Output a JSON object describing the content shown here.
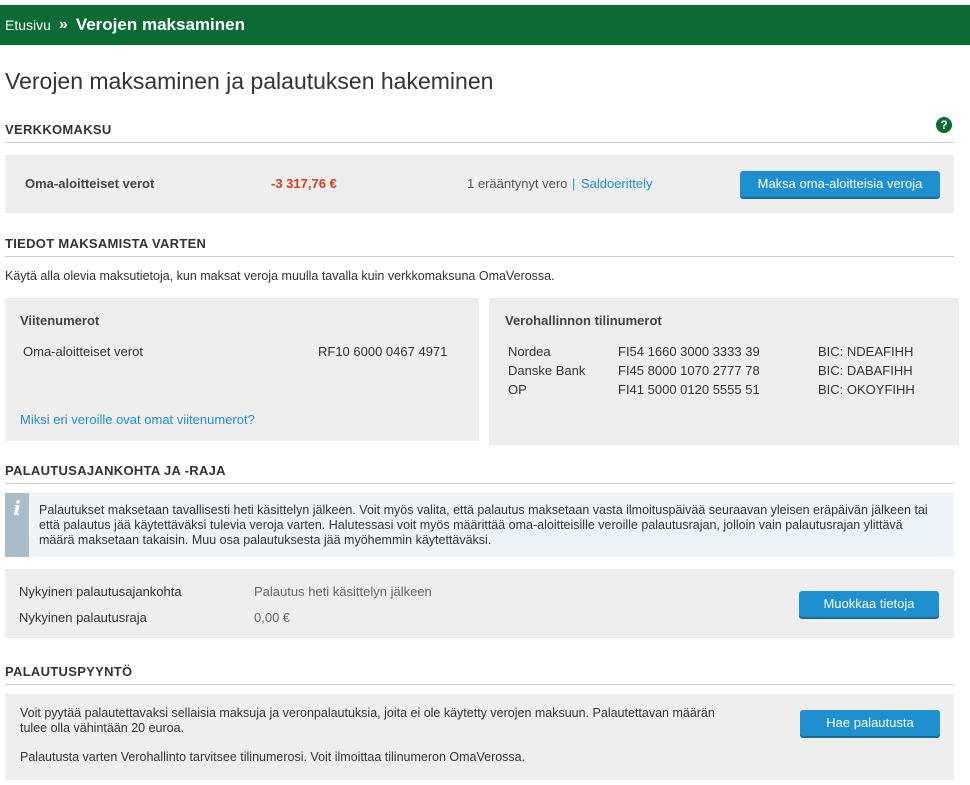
{
  "header": {
    "home": "Etusivu",
    "separator": "»",
    "current": "Verojen maksaminen"
  },
  "page_title": "Verojen maksaminen ja palautuksen hakeminen",
  "help_icon_label": "?",
  "verkkomaksu": {
    "heading": "VERKKOMAKSU",
    "label": "Oma-aloitteiset verot",
    "amount": "-3 317,76 €",
    "overdue": "1 erääntynyt vero",
    "divider": "|",
    "breakdown_link": "Saldoerittely",
    "pay_button": "Maksa oma-aloitteisia veroja"
  },
  "tiedot": {
    "heading": "TIEDOT MAKSAMISTA VARTEN",
    "intro": "Käytä alla olevia maksutietoja, kun maksat veroja muulla tavalla kuin verkkomaksuna OmaVerossa.",
    "reference": {
      "title": "Viitenumerot",
      "label": "Oma-aloitteiset verot",
      "value": "RF10 6000 0467 4971",
      "link": "Miksi eri veroille ovat omat viitenumerot?"
    },
    "accounts": {
      "title": "Verohallinnon tilinumerot",
      "rows": [
        {
          "bank": "Nordea",
          "iban": "FI54 1660 3000 3333 39",
          "bic": "BIC: NDEAFIHH"
        },
        {
          "bank": "Danske Bank",
          "iban": "FI45 8000 1070 2777 78",
          "bic": "BIC: DABAFIHH"
        },
        {
          "bank": "OP",
          "iban": "FI41 5000 0120 5555 51",
          "bic": "BIC: OKOYFIHH"
        }
      ]
    }
  },
  "palautus": {
    "heading": "PALAUTUSAJANKOHTA JA -RAJA",
    "info_icon": "i",
    "info_text": "Palautukset maksetaan tavallisesti heti käsittelyn jälkeen. Voit myös valita, että palautus maksetaan vasta ilmoituspäivää seuraavan yleisen eräpäivän jälkeen tai että palautus jää käytettäväksi tulevia veroja varten. Halutessasi voit myös määrittää oma-aloitteisille veroille palautusrajan, jolloin vain palautusrajan ylittävä määrä maksetaan takaisin. Muu osa palautuksesta jää myöhemmin käytettäväksi.",
    "time_label": "Nykyinen palautusajankohta",
    "time_value": "Palautus heti käsittelyn jälkeen",
    "limit_label": "Nykyinen palautusraja",
    "limit_value": "0,00 €",
    "edit_button": "Muokkaa tietoja"
  },
  "palautuspyynto": {
    "heading": "PALAUTUSPYYNTÖ",
    "text1": "Voit pyytää palautettavaksi sellaisia maksuja ja veronpalautuksia, joita ei ole käytetty verojen maksuun. Palautettavan määrän tulee olla vähintään 20 euroa.",
    "text2": "Palautusta varten Verohallinto tarvitsee tilinumerosi. Voit ilmoittaa tilinumeron OmaVerossa.",
    "button": "Hae palautusta"
  },
  "colors": {
    "brand": "#0a6b35",
    "accent": "#1e8fcf",
    "negative": "#d93a1c"
  }
}
